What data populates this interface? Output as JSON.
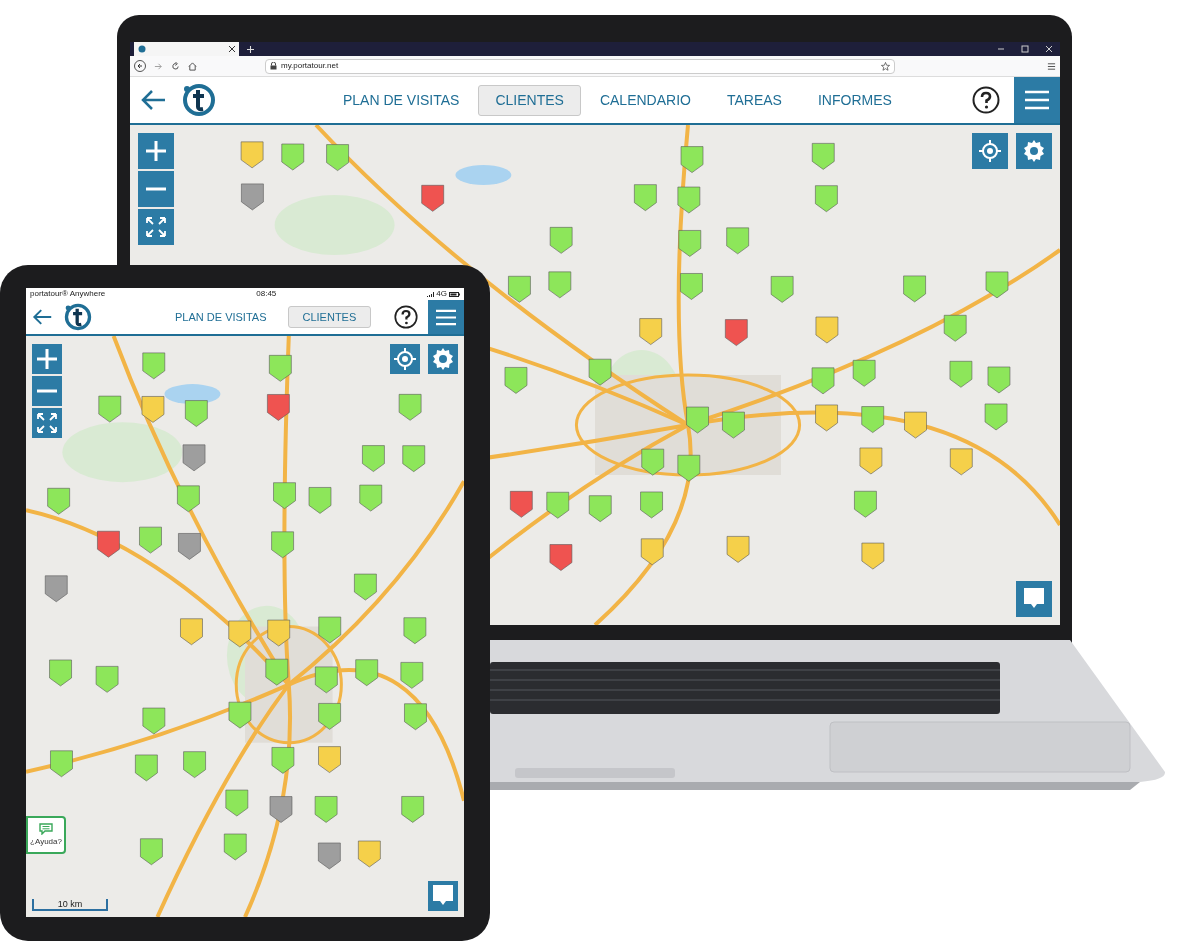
{
  "laptop": {
    "browser": {
      "url": "my.portatour.net"
    },
    "app": {
      "tabs": [
        {
          "label": "PLAN DE VISITAS",
          "selected": false
        },
        {
          "label": "CLIENTES",
          "selected": true
        },
        {
          "label": "CALENDARIO",
          "selected": false
        },
        {
          "label": "TAREAS",
          "selected": false
        },
        {
          "label": "INFORMES",
          "selected": false
        }
      ]
    }
  },
  "tablet": {
    "status_bar": {
      "app_name": "portatour® Anywhere",
      "time": "08:45",
      "network": "4G"
    },
    "app": {
      "tabs": [
        {
          "label": "PLAN DE VISITAS",
          "selected": false
        },
        {
          "label": "CLIENTES",
          "selected": true
        }
      ]
    },
    "help_button": {
      "label": "¿Ayuda?"
    },
    "scale_bar": {
      "label": "10 km"
    }
  }
}
